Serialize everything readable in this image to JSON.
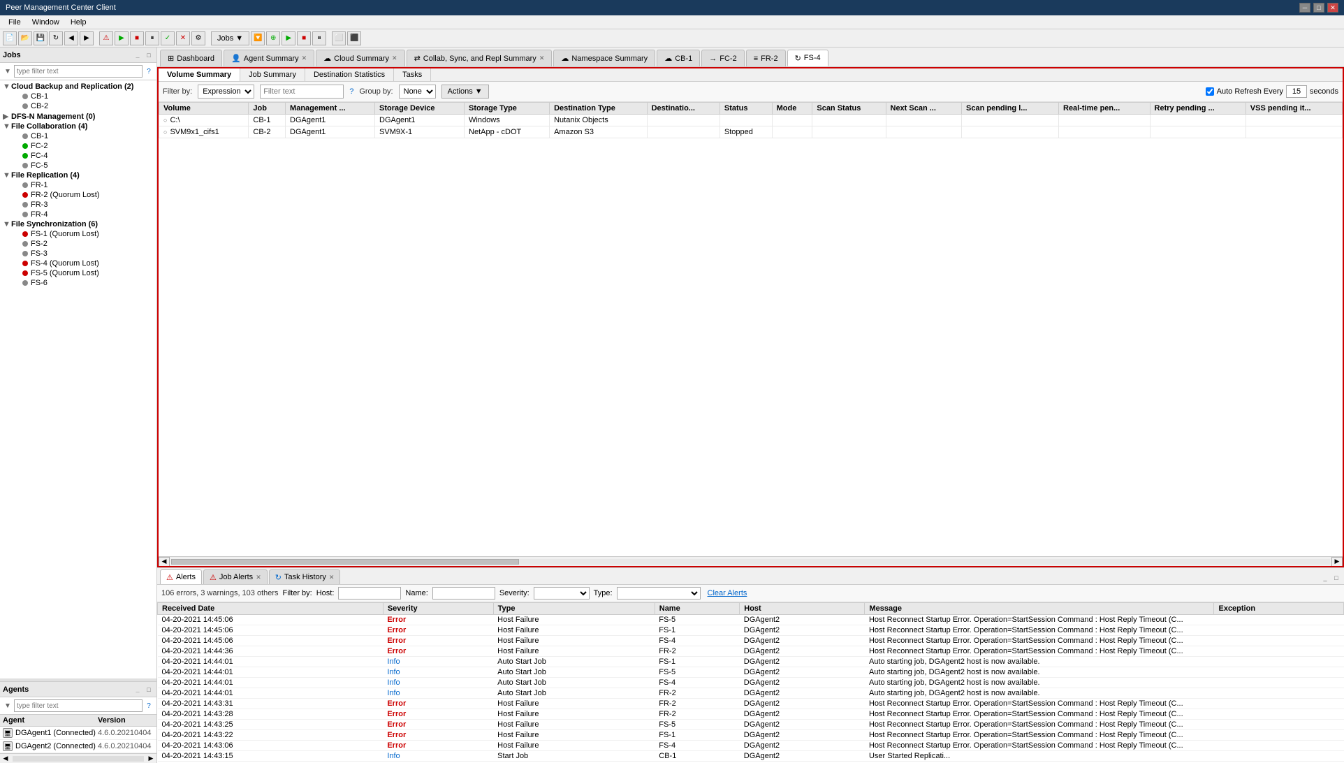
{
  "titleBar": {
    "title": "Peer Management Center Client",
    "controls": [
      "minimize",
      "maximize",
      "close"
    ]
  },
  "menuBar": {
    "items": [
      "File",
      "Window",
      "Help"
    ]
  },
  "leftPanel": {
    "jobs": {
      "header": "Jobs",
      "filterPlaceholder": "type filter text",
      "groups": [
        {
          "name": "Cloud Backup and Replication (2)",
          "expanded": true,
          "children": [
            {
              "name": "CB-1",
              "status": "gray"
            },
            {
              "name": "CB-2",
              "status": "gray"
            }
          ]
        },
        {
          "name": "DFS-N Management (0)",
          "expanded": false,
          "children": []
        },
        {
          "name": "File Collaboration (4)",
          "expanded": true,
          "children": [
            {
              "name": "CB-1",
              "status": "gray"
            },
            {
              "name": "FC-2",
              "status": "green"
            },
            {
              "name": "FC-4",
              "status": "green"
            },
            {
              "name": "FC-5",
              "status": "gray"
            }
          ]
        },
        {
          "name": "File Replication (4)",
          "expanded": true,
          "children": [
            {
              "name": "FR-1",
              "status": "gray"
            },
            {
              "name": "FR-2 (Quorum Lost)",
              "status": "red"
            },
            {
              "name": "FR-3",
              "status": "gray"
            },
            {
              "name": "FR-4",
              "status": "gray"
            }
          ]
        },
        {
          "name": "File Synchronization (6)",
          "expanded": true,
          "children": [
            {
              "name": "FS-1 (Quorum Lost)",
              "status": "red"
            },
            {
              "name": "FS-2",
              "status": "gray"
            },
            {
              "name": "FS-3",
              "status": "gray"
            },
            {
              "name": "FS-4 (Quorum Lost)",
              "status": "red"
            },
            {
              "name": "FS-5 (Quorum Lost)",
              "status": "red"
            },
            {
              "name": "FS-6",
              "status": "gray"
            }
          ]
        }
      ]
    },
    "agents": {
      "header": "Agents",
      "filterPlaceholder": "type filter text",
      "columns": [
        "Agent",
        "Version"
      ],
      "rows": [
        {
          "name": "DGAgent1 (Connected)",
          "version": "4.6.0.20210404"
        },
        {
          "name": "DGAgent2 (Connected)",
          "version": "4.6.0.20210404"
        }
      ]
    }
  },
  "topTabs": [
    {
      "label": "Dashboard",
      "icon": "⊞",
      "active": false,
      "closeable": false
    },
    {
      "label": "Agent Summary",
      "icon": "👤",
      "active": false,
      "closeable": true
    },
    {
      "label": "Cloud Summary",
      "icon": "☁",
      "active": false,
      "closeable": true
    },
    {
      "label": "Collab, Sync, and Repl Summary",
      "icon": "⇄",
      "active": false,
      "closeable": true
    },
    {
      "label": "Namespace Summary",
      "icon": "☁",
      "active": false,
      "closeable": false
    },
    {
      "label": "CB-1",
      "icon": "☁",
      "active": false,
      "closeable": false
    },
    {
      "label": "FC-2",
      "icon": "→",
      "active": false,
      "closeable": false
    },
    {
      "label": "FR-2",
      "icon": "≡",
      "active": false,
      "closeable": false
    },
    {
      "label": "FS-4",
      "icon": "↻",
      "active": true,
      "closeable": false
    }
  ],
  "subTabs": [
    "Volume Summary",
    "Job Summary",
    "Destination Statistics",
    "Tasks"
  ],
  "activeSubTab": "Volume Summary",
  "tableFilter": {
    "filterByLabel": "Filter by:",
    "filterByOptions": [
      "Expression"
    ],
    "filterBySelected": "Expression",
    "filterTextPlaceholder": "Filter text",
    "groupByLabel": "Group by:",
    "groupByOptions": [
      "None"
    ],
    "groupBySelected": "None",
    "actionsLabel": "Actions",
    "autoRefreshLabel": "Auto Refresh Every",
    "autoRefreshValue": "15",
    "autoRefreshUnit": "seconds",
    "autoRefreshChecked": true
  },
  "volumeTable": {
    "columns": [
      "Volume",
      "Job",
      "Management ...",
      "Storage Device",
      "Storage Type",
      "Destination Type",
      "Destinatio...",
      "Status",
      "Mode",
      "Scan Status",
      "Next Scan ...",
      "Scan pending l...",
      "Real-time pen...",
      "Retry pending ...",
      "VSS pending it..."
    ],
    "rows": [
      {
        "icon": "○",
        "volume": "C:\\",
        "job": "CB-1",
        "management": "DGAgent1",
        "storageDevice": "DGAgent1",
        "storageType": "Windows",
        "destinationType": "Nutanix Objects",
        "destination": "",
        "status": "",
        "mode": "",
        "scanStatus": "",
        "nextScan": "",
        "scanPending": "",
        "realtime": "",
        "retryPending": "",
        "vssPending": ""
      },
      {
        "icon": "○",
        "volume": "SVM9x1_cifs1",
        "job": "CB-2",
        "management": "DGAgent1",
        "storageDevice": "SVM9X-1",
        "storageType": "NetApp - cDOT",
        "destinationType": "Amazon S3",
        "destination": "",
        "status": "Stopped",
        "mode": "",
        "scanStatus": "",
        "nextScan": "",
        "scanPending": "",
        "realtime": "",
        "retryPending": "",
        "vssPending": ""
      }
    ]
  },
  "lowerTabs": [
    {
      "label": "Alerts",
      "icon": "⚠",
      "active": true,
      "closeable": false
    },
    {
      "label": "Job Alerts",
      "icon": "⚠",
      "active": false,
      "closeable": true
    },
    {
      "label": "Task History",
      "icon": "↻",
      "active": false,
      "closeable": true
    }
  ],
  "alertsFilter": {
    "summary": "106 errors, 3 warnings, 103 others",
    "filterByLabel": "Filter by:",
    "hostLabel": "Host:",
    "nameLabel": "Name:",
    "severityLabel": "Severity:",
    "typeLabel": "Type:",
    "clearLabel": "Clear Alerts"
  },
  "alertsTable": {
    "columns": [
      "Received Date",
      "Severity",
      "Type",
      "Name",
      "Host",
      "Message",
      "Exception"
    ],
    "rows": [
      {
        "date": "04-20-2021 14:45:06",
        "severity": "Error",
        "type": "Host Failure",
        "name": "FS-5",
        "host": "DGAgent2",
        "message": "Host Reconnect Startup Error.  Operation=StartSession Command : Host Reply Timeout (C...",
        "exception": ""
      },
      {
        "date": "04-20-2021 14:45:06",
        "severity": "Error",
        "type": "Host Failure",
        "name": "FS-1",
        "host": "DGAgent2",
        "message": "Host Reconnect Startup Error.  Operation=StartSession Command : Host Reply Timeout (C...",
        "exception": ""
      },
      {
        "date": "04-20-2021 14:45:06",
        "severity": "Error",
        "type": "Host Failure",
        "name": "FS-4",
        "host": "DGAgent2",
        "message": "Host Reconnect Startup Error.  Operation=StartSession Command : Host Reply Timeout (C...",
        "exception": ""
      },
      {
        "date": "04-20-2021 14:44:36",
        "severity": "Error",
        "type": "Host Failure",
        "name": "FR-2",
        "host": "DGAgent2",
        "message": "Host Reconnect Startup Error.  Operation=StartSession Command : Host Reply Timeout (C...",
        "exception": ""
      },
      {
        "date": "04-20-2021 14:44:01",
        "severity": "Info",
        "type": "Auto Start Job",
        "name": "FS-1",
        "host": "DGAgent2",
        "message": "Auto starting job, DGAgent2 host is now available.",
        "exception": ""
      },
      {
        "date": "04-20-2021 14:44:01",
        "severity": "Info",
        "type": "Auto Start Job",
        "name": "FS-5",
        "host": "DGAgent2",
        "message": "Auto starting job, DGAgent2 host is now available.",
        "exception": ""
      },
      {
        "date": "04-20-2021 14:44:01",
        "severity": "Info",
        "type": "Auto Start Job",
        "name": "FS-4",
        "host": "DGAgent2",
        "message": "Auto starting job, DGAgent2 host is now available.",
        "exception": ""
      },
      {
        "date": "04-20-2021 14:44:01",
        "severity": "Info",
        "type": "Auto Start Job",
        "name": "FR-2",
        "host": "DGAgent2",
        "message": "Auto starting job, DGAgent2 host is now available.",
        "exception": ""
      },
      {
        "date": "04-20-2021 14:43:31",
        "severity": "Error",
        "type": "Host Failure",
        "name": "FR-2",
        "host": "DGAgent2",
        "message": "Host Reconnect Startup Error.  Operation=StartSession Command : Host Reply Timeout (C...",
        "exception": ""
      },
      {
        "date": "04-20-2021 14:43:28",
        "severity": "Error",
        "type": "Host Failure",
        "name": "FR-2",
        "host": "DGAgent2",
        "message": "Host Reconnect Startup Error.  Operation=StartSession Command : Host Reply Timeout (C...",
        "exception": ""
      },
      {
        "date": "04-20-2021 14:43:25",
        "severity": "Error",
        "type": "Host Failure",
        "name": "FS-5",
        "host": "DGAgent2",
        "message": "Host Reconnect Startup Error.  Operation=StartSession Command : Host Reply Timeout (C...",
        "exception": ""
      },
      {
        "date": "04-20-2021 14:43:22",
        "severity": "Error",
        "type": "Host Failure",
        "name": "FS-1",
        "host": "DGAgent2",
        "message": "Host Reconnect Startup Error.  Operation=StartSession Command : Host Reply Timeout (C...",
        "exception": ""
      },
      {
        "date": "04-20-2021 14:43:06",
        "severity": "Error",
        "type": "Host Failure",
        "name": "FS-4",
        "host": "DGAgent2",
        "message": "Host Reconnect Startup Error.  Operation=StartSession Command : Host Reply Timeout (C...",
        "exception": ""
      },
      {
        "date": "04-20-2021 14:43:15",
        "severity": "Info",
        "type": "Start Job",
        "name": "CB-1",
        "host": "DGAgent2",
        "message": "User Started Replicati...",
        "exception": ""
      }
    ]
  }
}
